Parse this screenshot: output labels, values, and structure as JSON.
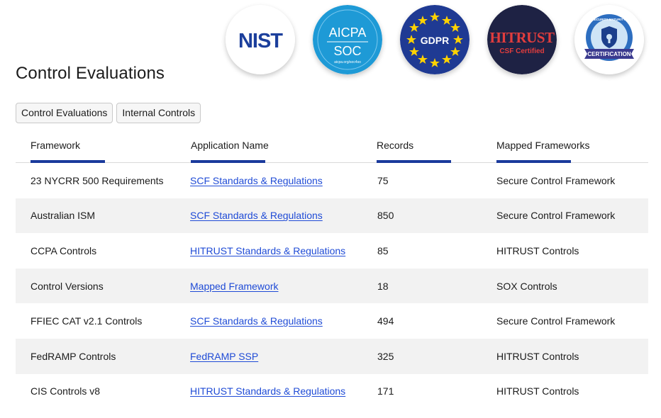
{
  "page": {
    "title": "Control Evaluations"
  },
  "badges": [
    {
      "name": "nist-badge",
      "text": "NIST"
    },
    {
      "name": "aicpa-soc-badge",
      "line1": "AICPA",
      "line2": "SOC",
      "caption": "aicpa.org/soc4so"
    },
    {
      "name": "gdpr-badge",
      "text": "GDPR"
    },
    {
      "name": "hitrust-badge",
      "line1": "HITRUST",
      "line2": "CSF Certified"
    },
    {
      "name": "cmmc-badge",
      "caption": "CYBERSECURITY MATURITY MODEL",
      "ribbon": "CERTIFICATION"
    }
  ],
  "colors": {
    "accent": "#1a3a9c",
    "link": "#1f4bd6",
    "row_alt": "#f2f2f2"
  },
  "tabs": [
    {
      "label": "Control Evaluations"
    },
    {
      "label": "Internal Controls"
    }
  ],
  "table": {
    "headers": [
      "Framework",
      "Application Name",
      "Records",
      "Mapped Frameworks"
    ],
    "rows": [
      {
        "framework": "23 NYCRR 500 Requirements",
        "application": "SCF Standards & Regulations",
        "records": "75",
        "mapped": "Secure Control Framework"
      },
      {
        "framework": "Australian ISM",
        "application": "SCF Standards & Regulations",
        "records": "850",
        "mapped": "Secure Control Framework"
      },
      {
        "framework": "CCPA Controls",
        "application": "HITRUST Standards & Regulations",
        "records": "85",
        "mapped": "HITRUST Controls"
      },
      {
        "framework": "Control Versions",
        "application": "Mapped Framework",
        "records": "18",
        "mapped": "SOX Controls"
      },
      {
        "framework": "FFIEC CAT v2.1 Controls",
        "application": "SCF Standards & Regulations",
        "records": "494",
        "mapped": "Secure Control Framework"
      },
      {
        "framework": "FedRAMP Controls",
        "application": "FedRAMP SSP",
        "records": "325",
        "mapped": "HITRUST Controls"
      },
      {
        "framework": "CIS Controls v8",
        "application": "HITRUST Standards & Regulations",
        "records": "171",
        "mapped": "HITRUST Controls"
      }
    ]
  }
}
